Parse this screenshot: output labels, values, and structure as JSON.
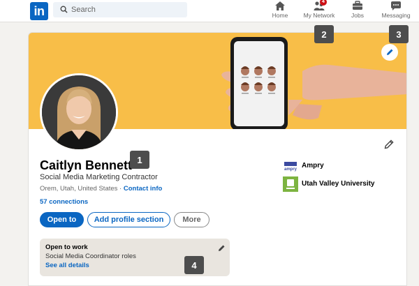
{
  "nav": {
    "logo": "in",
    "search_placeholder": "Search",
    "items": [
      {
        "label": "Home"
      },
      {
        "label": "My Network",
        "badge": "4"
      },
      {
        "label": "Jobs"
      },
      {
        "label": "Messaging"
      }
    ]
  },
  "profile": {
    "name": "Caitlyn Bennett",
    "headline": "Social Media Marketing Contractor",
    "location": "Orem, Utah, United States",
    "location_separator": " · ",
    "contact_info": "Contact info",
    "connections": "57 connections"
  },
  "actions": {
    "open_to": "Open to",
    "add_section": "Add profile section",
    "more": "More"
  },
  "open_to_work": {
    "title": "Open to work",
    "roles": "Social Media Coordinator roles",
    "link": "See all details"
  },
  "organizations": [
    {
      "name": "Ampry",
      "logo_text": "ampry"
    },
    {
      "name": "Utah Valley University"
    }
  ],
  "markers": [
    "1",
    "2",
    "3",
    "4"
  ],
  "colors": {
    "brand_blue": "#0a66c2",
    "banner_yellow": "#f8be48",
    "page_bg": "#f3f2ef",
    "marker_gray": "#4d4d4d",
    "uvu_green": "#7db441",
    "notification_red": "#cc1016"
  },
  "icons": [
    "search-icon",
    "home-icon",
    "network-icon",
    "jobs-icon",
    "messaging-icon",
    "pencil-icon"
  ]
}
